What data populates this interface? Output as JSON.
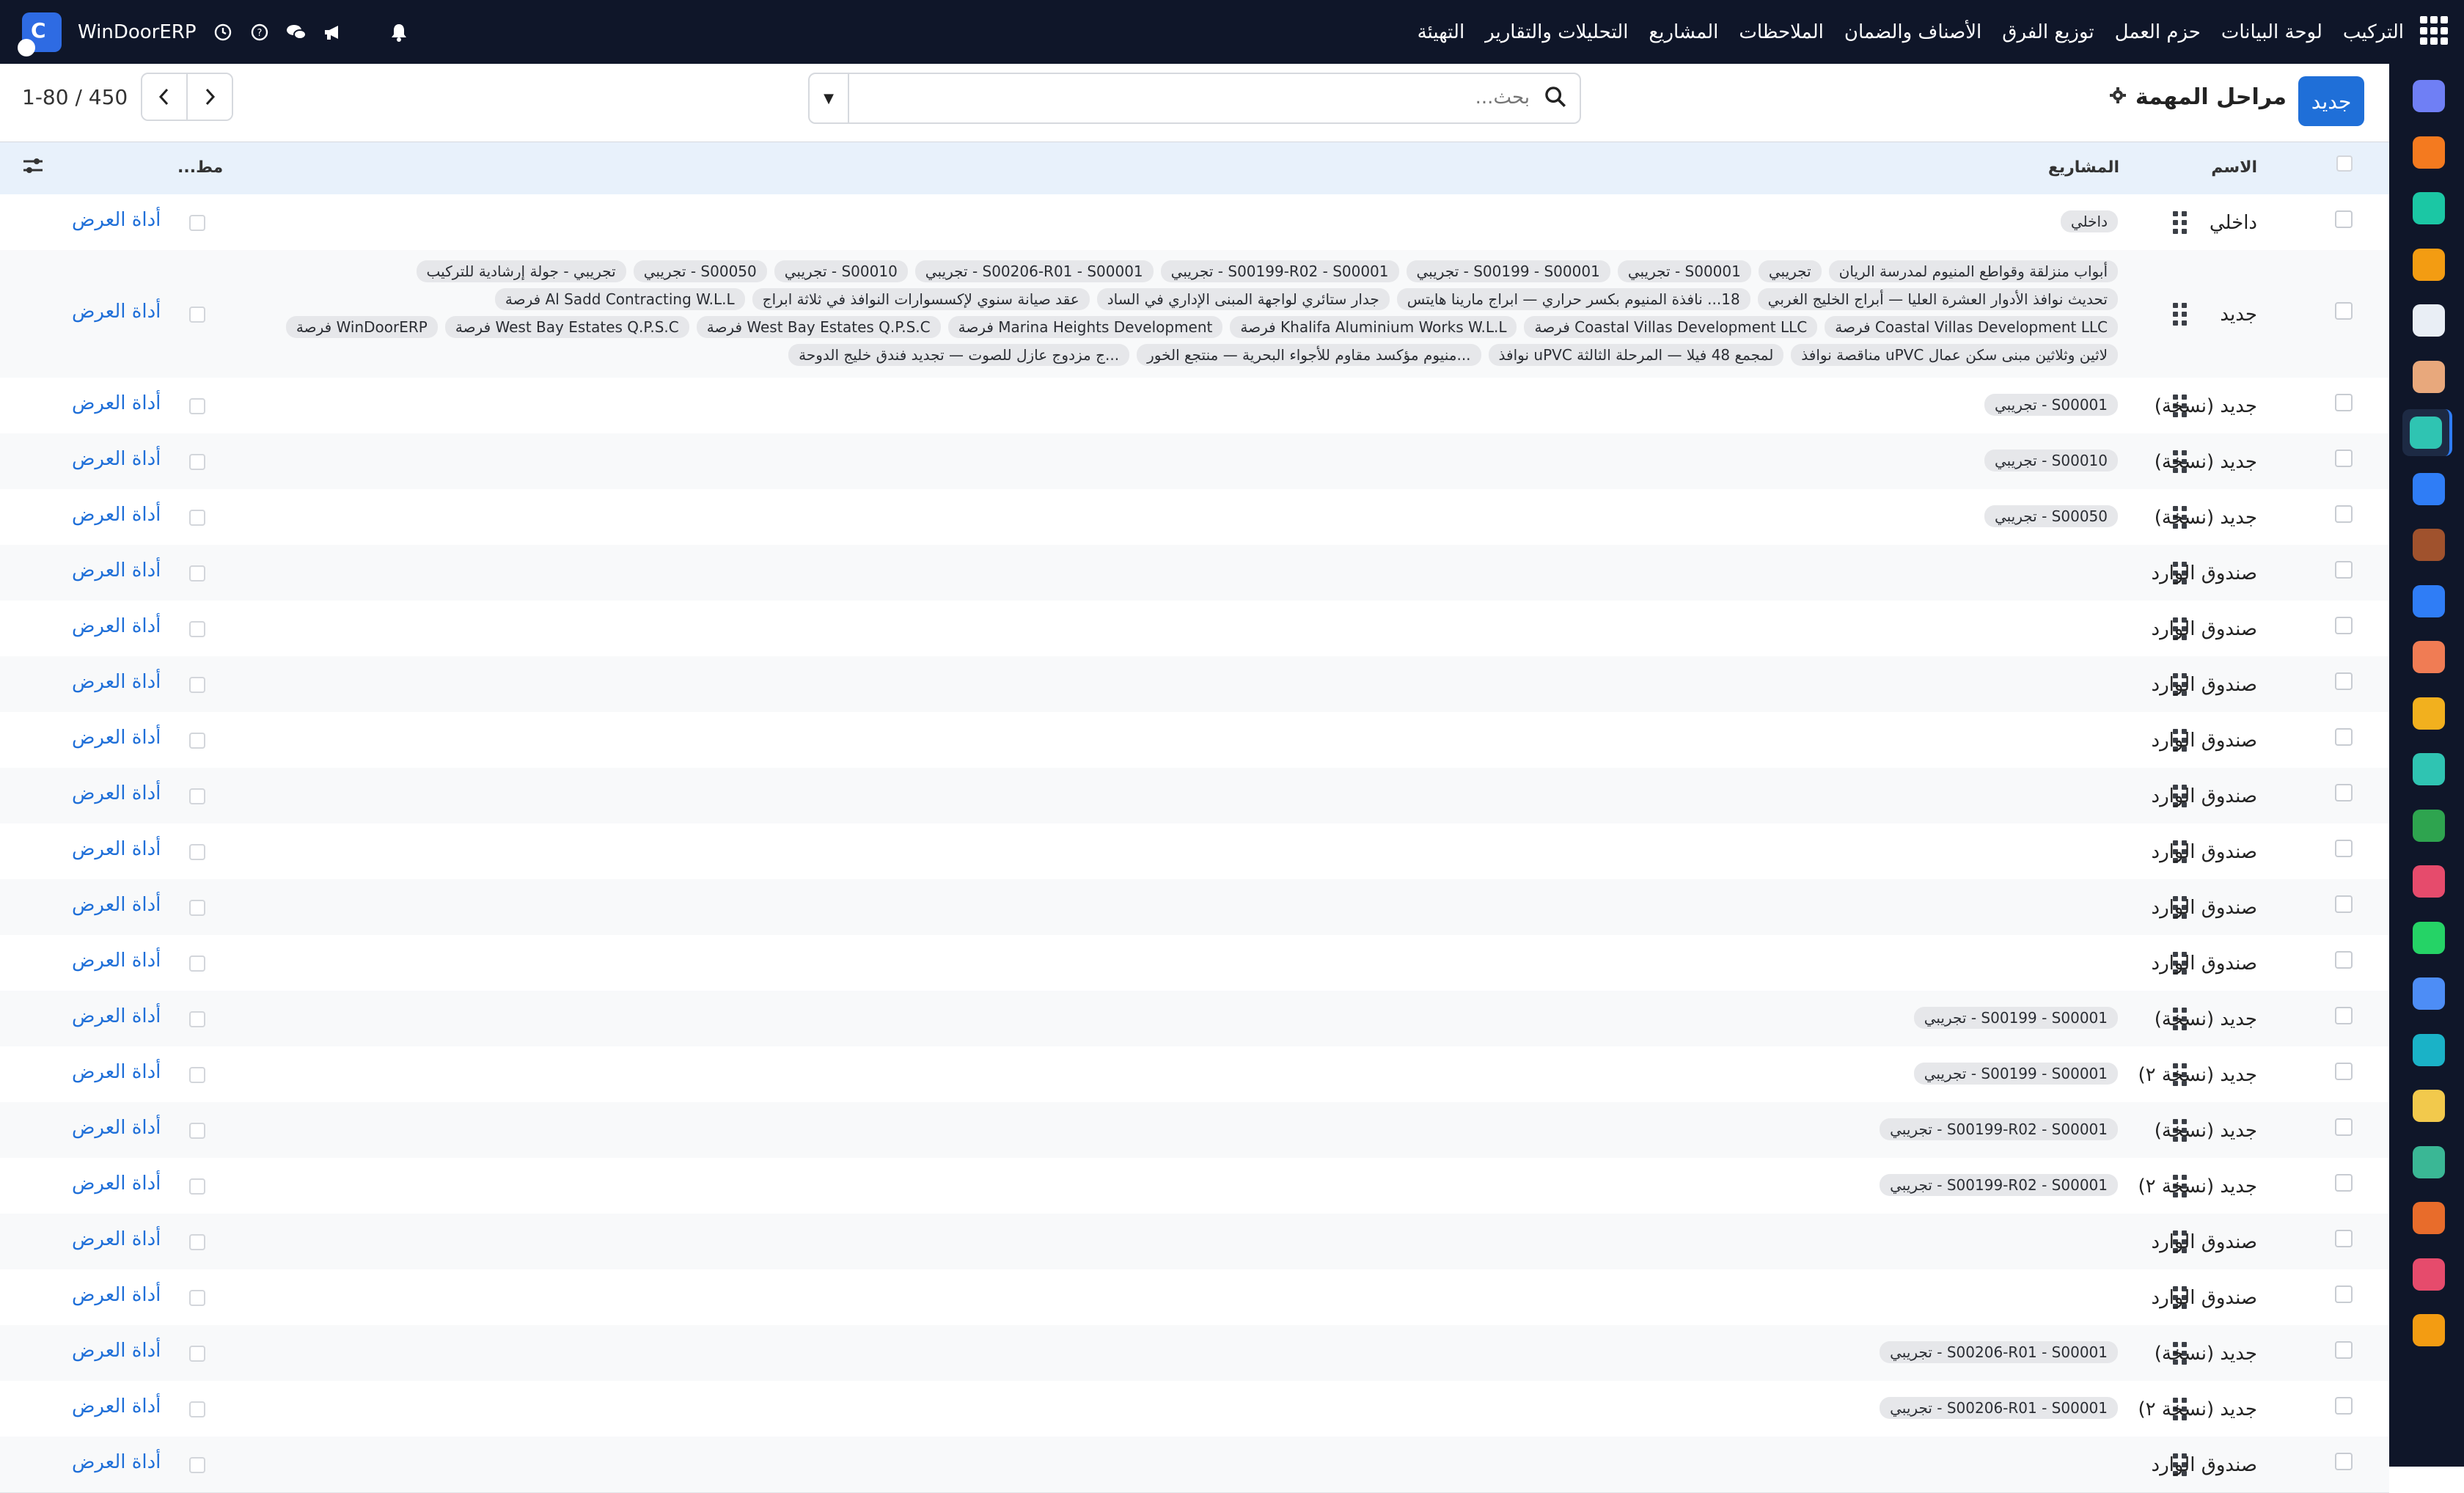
{
  "app": {
    "name": "WinDoorERP",
    "top_menu": [
      "التركيب",
      "لوحة البيانات",
      "حزم العمل",
      "توزيع الفرق",
      "الأصناف والضمان",
      "الملاحظات",
      "المشاريع",
      "التحليلات والتقارير",
      "التهيئة"
    ],
    "top_icons": [
      "clock-icon",
      "help-icon",
      "chat-icon",
      "megaphone-icon",
      "bell-icon"
    ]
  },
  "sidebar": {
    "icons": [
      {
        "name": "m-app-icon",
        "color": "#6f7ff5"
      },
      {
        "name": "chat-bubble-icon",
        "color": "#f47a1f"
      },
      {
        "name": "diamond-icon",
        "color": "#1bc7a4"
      },
      {
        "name": "bar-chart-icon",
        "color": "#f39c12"
      },
      {
        "name": "box-icon",
        "color": "#e9eef5"
      },
      {
        "name": "photo-icon",
        "color": "#e8a87c"
      },
      {
        "name": "tasks-icon",
        "color": "#2fc4b2",
        "active": true
      },
      {
        "name": "book-icon",
        "color": "#2f7df6"
      },
      {
        "name": "package-icon",
        "color": "#a0522d"
      },
      {
        "name": "invoice-icon",
        "color": "#2f7df6"
      },
      {
        "name": "people-icon",
        "color": "#f07c54"
      },
      {
        "name": "calendar-31-icon",
        "color": "#f2b01e"
      },
      {
        "name": "sign-icon",
        "color": "#2fc4b2"
      },
      {
        "name": "contact-icon",
        "color": "#2ea44f"
      },
      {
        "name": "dashboard-icon",
        "color": "#e64b6c"
      },
      {
        "name": "whatsapp-icon",
        "color": "#25d366"
      },
      {
        "name": "clock-app-icon",
        "color": "#4d8df6"
      },
      {
        "name": "wave-icon",
        "color": "#1ab2c7"
      },
      {
        "name": "send-icon",
        "color": "#f2c94c"
      },
      {
        "name": "layers-icon",
        "color": "#3ab795"
      },
      {
        "name": "hexagon-icon",
        "color": "#e86c2b"
      },
      {
        "name": "pie-icon",
        "color": "#e64b6c"
      },
      {
        "name": "puzzle-icon",
        "color": "#f39c12"
      }
    ]
  },
  "control": {
    "new_button": "جديد",
    "title": "مراحل المهمة",
    "search_placeholder": "بحث...",
    "pager_text": "1-80 / 450"
  },
  "table": {
    "headers": {
      "name": "الاسم",
      "projects": "المشاريع",
      "widget": "مط..."
    },
    "widget_label": "أداة العرض",
    "rows": [
      {
        "name": "داخلي",
        "tags": [
          "داخلي"
        ]
      },
      {
        "name": "جديد",
        "tags": [
          "أبواب منزلقة وقواطع المنيوم لمدرسة الريان",
          "تجريبي",
          "S00001 - تجريبي",
          "S00199 - S00001 - تجريبي",
          "S00199-R02 - S00001 - تجريبي",
          "S00206-R01 - S00001 - تجريبي",
          "S00010 - تجريبي",
          "S00050 - تجريبي",
          "تجريبي - جولة إرشادية للتركيب",
          "تحديث نوافذ الأدوار العشرة العليا — أبراج الخليج الغربي",
          "18... نافذة المنيوم بكسر حراري — ابراج مارينا هايتس",
          "جدار ستائري لواجهة المبنى الإداري في الساد",
          "عقد صيانة سنوي لإكسسوارات النوافذ في ثلاثة ابراج",
          "Al Sadd Contracting W.L.L فرصة",
          "Coastal Villas Development LLC فرصة",
          "Coastal Villas Development LLC فرصة",
          "Khalifa Aluminium Works W.L.L فرصة",
          "Marina Heights Development فرصة",
          "West Bay Estates Q.P.S.C فرصة",
          "West Bay Estates Q.P.S.C فرصة",
          "WinDoorERP فرصة",
          "لاثين وثلاثين مبنى سكن عمال uPVC مناقصة نوافذ",
          "لمجمع 48 فيلا — المرحلة الثالثة uPVC نوافذ",
          "...منيوم مؤكسد مقاوم للأجواء البحرية — منتجع الخور",
          "...ج مزدوج عازل للصوت — تجديد فندق خليج الدوحة"
        ]
      },
      {
        "name": "جديد (نسخة)",
        "tags": [
          "S00001 - تجريبي"
        ]
      },
      {
        "name": "جديد (نسخة)",
        "tags": [
          "S00010 - تجريبي"
        ]
      },
      {
        "name": "جديد (نسخة)",
        "tags": [
          "S00050 - تجريبي"
        ]
      },
      {
        "name": "صندوق الوارد",
        "tags": []
      },
      {
        "name": "صندوق الوارد",
        "tags": []
      },
      {
        "name": "صندوق الوارد",
        "tags": []
      },
      {
        "name": "صندوق الوارد",
        "tags": []
      },
      {
        "name": "صندوق الوارد",
        "tags": []
      },
      {
        "name": "صندوق الوارد",
        "tags": []
      },
      {
        "name": "صندوق الوارد",
        "tags": []
      },
      {
        "name": "صندوق الوارد",
        "tags": []
      },
      {
        "name": "جديد (نسخة)",
        "tags": [
          "S00199 - S00001 - تجريبي"
        ]
      },
      {
        "name": "جديد (نسخة ٢)",
        "tags": [
          "S00199 - S00001 - تجريبي"
        ]
      },
      {
        "name": "جديد (نسخة)",
        "tags": [
          "S00199-R02 - S00001 - تجريبي"
        ]
      },
      {
        "name": "جديد (نسخة ٢)",
        "tags": [
          "S00199-R02 - S00001 - تجريبي"
        ]
      },
      {
        "name": "صندوق الوارد",
        "tags": []
      },
      {
        "name": "صندوق الوارد",
        "tags": []
      },
      {
        "name": "جديد (نسخة)",
        "tags": [
          "S00206-R01 - S00001 - تجريبي"
        ]
      },
      {
        "name": "جديد (نسخة ٢)",
        "tags": [
          "S00206-R01 - S00001 - تجريبي"
        ]
      },
      {
        "name": "صندوق الوارد",
        "tags": []
      }
    ]
  }
}
